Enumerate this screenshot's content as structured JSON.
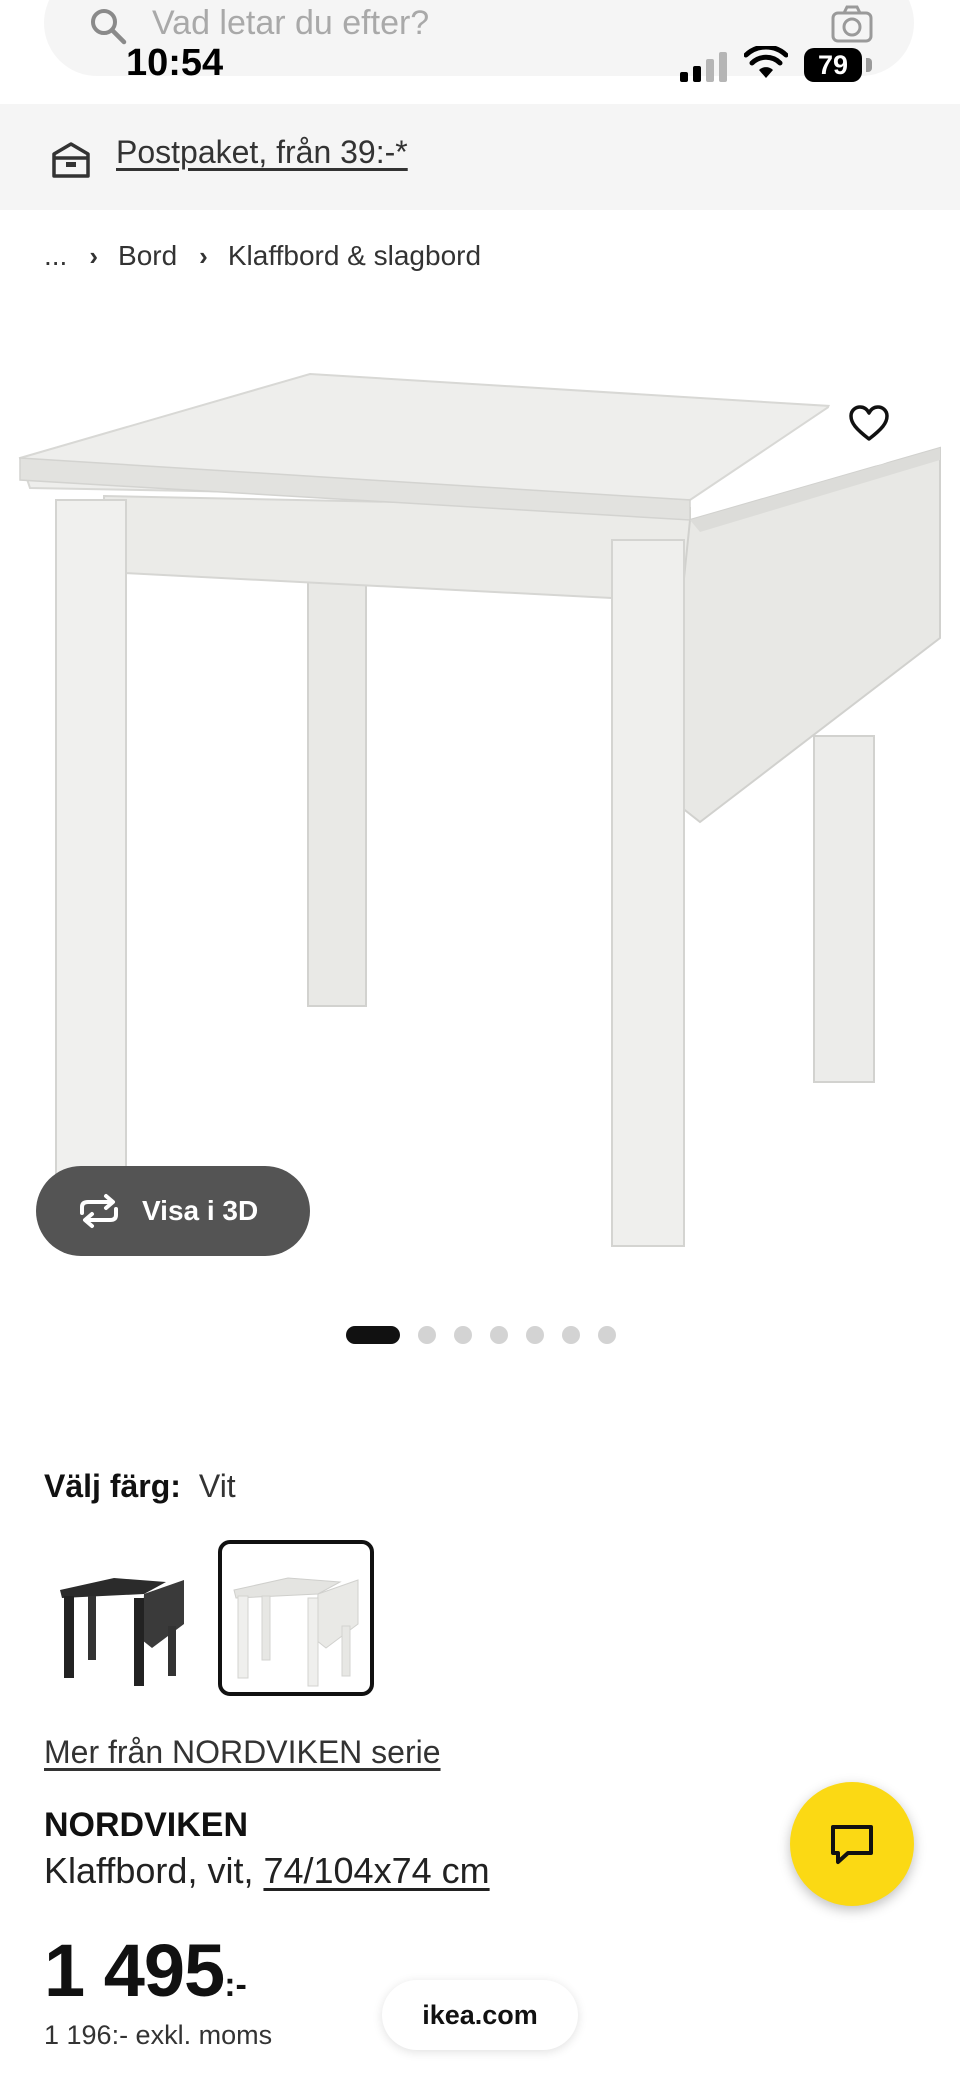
{
  "search": {
    "placeholder": "Vad letar du efter?"
  },
  "status_bar": {
    "time": "10:54",
    "battery": "79"
  },
  "banner": {
    "shipping_text": "Postpaket, från 39:-*"
  },
  "breadcrumb": {
    "ellipsis": "...",
    "items": [
      "Bord",
      "Klaffbord & slagbord"
    ]
  },
  "media": {
    "view_3d_label": "Visa i 3D",
    "slide_count": 7,
    "active_slide": 1
  },
  "color": {
    "label": "Välj färg:",
    "value": "Vit",
    "options": [
      "black",
      "white"
    ],
    "selected": "white"
  },
  "series_link": "Mer från NORDVIKEN serie",
  "product": {
    "name": "NORDVIKEN",
    "description_prefix": "Klaffbord, vit, ",
    "dimensions": "74/104x74 cm"
  },
  "price": {
    "main": "1 495",
    "suffix": ":-",
    "excl_vat": "1 196:- exkl. moms"
  },
  "footer": {
    "url": "ikea.com"
  },
  "colors": {
    "accent_yellow": "#fbd914",
    "dark_button": "#545454",
    "light_bg": "#f5f5f5"
  }
}
